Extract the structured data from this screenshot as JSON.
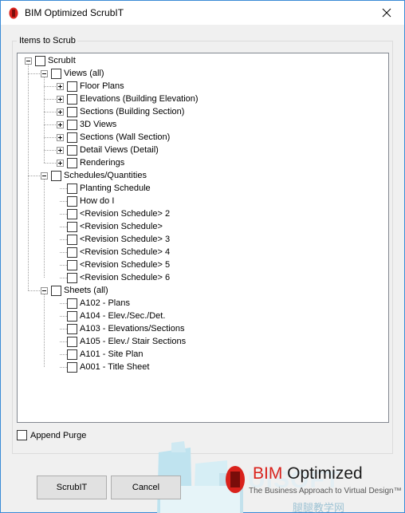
{
  "window": {
    "title": "BIM Optimized ScrubIT",
    "close_glyph": "✕"
  },
  "group": {
    "legend": "Items to Scrub"
  },
  "tree": [
    {
      "label": "ScrubIt",
      "depth": 0,
      "expander": "minus"
    },
    {
      "label": "Views (all)",
      "depth": 1,
      "expander": "minus"
    },
    {
      "label": "Floor Plans",
      "depth": 2,
      "expander": "plus"
    },
    {
      "label": "Elevations (Building Elevation)",
      "depth": 2,
      "expander": "plus"
    },
    {
      "label": "Sections (Building Section)",
      "depth": 2,
      "expander": "plus"
    },
    {
      "label": "3D Views",
      "depth": 2,
      "expander": "plus"
    },
    {
      "label": "Sections (Wall Section)",
      "depth": 2,
      "expander": "plus"
    },
    {
      "label": "Detail Views (Detail)",
      "depth": 2,
      "expander": "plus"
    },
    {
      "label": "Renderings",
      "depth": 2,
      "expander": "plus"
    },
    {
      "label": "Schedules/Quantities",
      "depth": 1,
      "expander": "minus"
    },
    {
      "label": "Planting Schedule",
      "depth": 2,
      "expander": "none"
    },
    {
      "label": "How do I",
      "depth": 2,
      "expander": "none"
    },
    {
      "label": "<Revision Schedule> 2",
      "depth": 2,
      "expander": "none"
    },
    {
      "label": "<Revision Schedule>",
      "depth": 2,
      "expander": "none"
    },
    {
      "label": "<Revision Schedule> 3",
      "depth": 2,
      "expander": "none"
    },
    {
      "label": "<Revision Schedule> 4",
      "depth": 2,
      "expander": "none"
    },
    {
      "label": "<Revision Schedule> 5",
      "depth": 2,
      "expander": "none"
    },
    {
      "label": "<Revision Schedule> 6",
      "depth": 2,
      "expander": "none"
    },
    {
      "label": "Sheets (all)",
      "depth": 1,
      "expander": "minus"
    },
    {
      "label": "A102 - Plans",
      "depth": 2,
      "expander": "none"
    },
    {
      "label": "A104 - Elev./Sec./Det.",
      "depth": 2,
      "expander": "none"
    },
    {
      "label": "A103 - Elevations/Sections",
      "depth": 2,
      "expander": "none"
    },
    {
      "label": "A105 - Elev./ Stair Sections",
      "depth": 2,
      "expander": "none"
    },
    {
      "label": "A101 - Site Plan",
      "depth": 2,
      "expander": "none"
    },
    {
      "label": "A001 - Title Sheet",
      "depth": 2,
      "expander": "none"
    }
  ],
  "options": {
    "append_purge_label": "Append Purge",
    "append_purge_checked": false
  },
  "buttons": {
    "scrub_label": "ScrubIT",
    "cancel_label": "Cancel"
  },
  "brand": {
    "name_prefix": "BIM ",
    "name_accent": "Optimized",
    "tagline": "The Business Approach to Virtual Design™",
    "accent_color": "#d9221c"
  },
  "colors": {
    "window_border": "#3a8bd6",
    "dialog_bg": "#f0f0f0",
    "button_bg": "#e1e1e1"
  }
}
